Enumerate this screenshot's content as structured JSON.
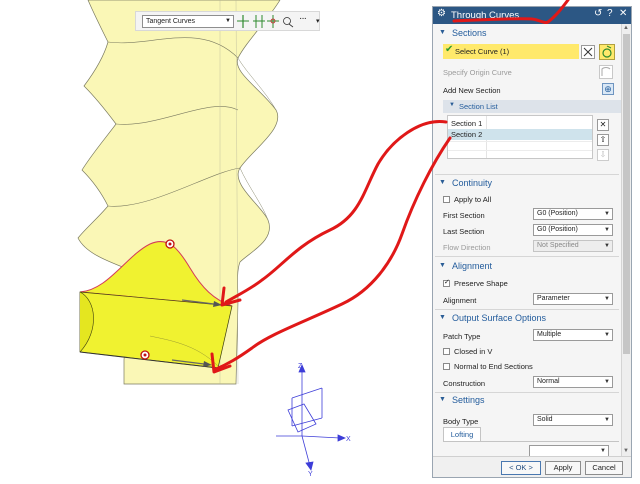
{
  "viewport": {
    "selection_filter": "Tangent Curves",
    "axis_labels": {
      "z": "Z",
      "x": "X",
      "y": "Y"
    }
  },
  "dialog": {
    "title": "Through Curves",
    "sections": {
      "header": "Sections",
      "select_curve": "Select Curve (1)",
      "specify_origin": "Specify Origin Curve",
      "add_new_section": "Add New Section",
      "section_list_header": "Section List",
      "items": [
        "Section  1",
        "Section  2"
      ]
    },
    "continuity": {
      "header": "Continuity",
      "apply_to_all": "Apply to All",
      "first_section_label": "First Section",
      "first_section_value": "G0 (Position)",
      "last_section_label": "Last Section",
      "last_section_value": "G0 (Position)",
      "flow_direction_label": "Flow Direction",
      "flow_direction_value": "Not Specified"
    },
    "alignment": {
      "header": "Alignment",
      "preserve_shape": "Preserve Shape",
      "alignment_label": "Alignment",
      "alignment_value": "Parameter"
    },
    "output": {
      "header": "Output Surface Options",
      "patch_type_label": "Patch Type",
      "patch_type_value": "Multiple",
      "closed_in_v": "Closed in V",
      "normal_to_end": "Normal to End Sections",
      "construction_label": "Construction",
      "construction_value": "Normal"
    },
    "settings": {
      "header": "Settings",
      "body_type_label": "Body Type",
      "body_type_value": "Solid",
      "tab_lofting": "Lofting"
    },
    "buttons": {
      "ok": "< OK >",
      "apply": "Apply",
      "cancel": "Cancel"
    }
  },
  "colors": {
    "title_bar": "#2c5784",
    "selected_row": "#ffe96b",
    "surface": "#faf7a8",
    "highlight_sheet": "#f0f230",
    "annotation": "#e01818"
  }
}
